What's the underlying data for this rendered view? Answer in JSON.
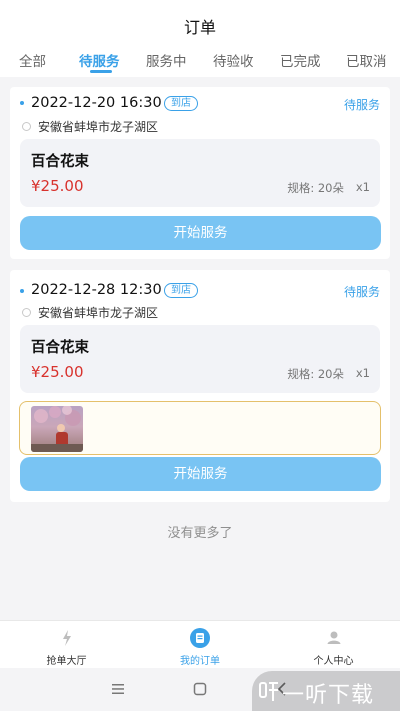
{
  "header": {
    "title": "订单",
    "tabs": [
      {
        "label": "全部"
      },
      {
        "label": "待服务"
      },
      {
        "label": "服务中"
      },
      {
        "label": "待验收"
      },
      {
        "label": "已完成"
      },
      {
        "label": "已取消"
      }
    ],
    "active_tab": "待服务"
  },
  "orders": [
    {
      "datetime": "2022-12-20 16:30",
      "badge": "到店",
      "status": "待服务",
      "address": "安徽省蚌埠市龙子湖区",
      "product_name": "百合花束",
      "price": "¥25.00",
      "spec": "规格: 20朵",
      "qty": "x1",
      "action_label": "开始服务"
    },
    {
      "datetime": "2022-12-28 12:30",
      "badge": "到店",
      "status": "待服务",
      "address": "安徽省蚌埠市龙子湖区",
      "product_name": "百合花束",
      "price": "¥25.00",
      "spec": "规格: 20朵",
      "qty": "x1",
      "action_label": "开始服务"
    }
  ],
  "list_end_text": "没有更多了",
  "tabbar": [
    {
      "label": "抢单大厅",
      "icon": "lightning-icon"
    },
    {
      "label": "我的订单",
      "icon": "order-icon"
    },
    {
      "label": "个人中心",
      "icon": "person-icon"
    }
  ],
  "watermark": {
    "text": "一听下载"
  },
  "colors": {
    "accent": "#3aa1e8",
    "button": "#79c4f3",
    "price": "#d8322d",
    "photo_border": "#e4c06b"
  }
}
